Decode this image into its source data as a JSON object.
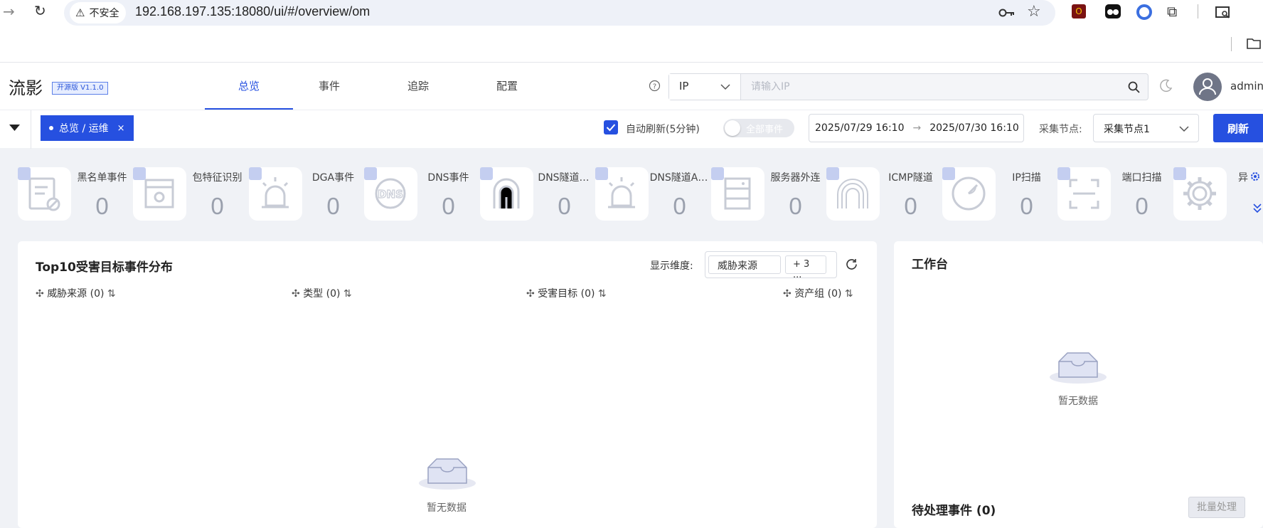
{
  "browser": {
    "security_label": "不安全",
    "url": "192.168.197.135:18080/ui/#/overview/om"
  },
  "app": {
    "logo": "流影",
    "version": "开源版 V1.1.0",
    "nav": [
      "总览",
      "事件",
      "追踪",
      "配置"
    ],
    "active_nav": "总览",
    "search_type": "IP",
    "search_placeholder": "请输入IP",
    "user": "admin"
  },
  "toolbar": {
    "breadcrumb": "总览 / 运维",
    "auto_refresh_label": "自动刷新(5分钟)",
    "auto_refresh_checked": true,
    "all_events_label": "全部事件",
    "date_start": "2025/07/29 16:10",
    "date_arrow": "→",
    "date_end": "2025/07/30 16:10",
    "node_label": "采集节点:",
    "node_value": "采集节点1",
    "refresh_label": "刷新"
  },
  "event_cards": [
    {
      "label": "黑名单事件",
      "count": "0",
      "icon": "blacklist-icon"
    },
    {
      "label": "包特征识别",
      "count": "0",
      "icon": "packet-icon"
    },
    {
      "label": "DGA事件",
      "count": "0",
      "icon": "alarm-icon"
    },
    {
      "label": "DNS事件",
      "count": "0",
      "icon": "dns-icon"
    },
    {
      "label": "DNS隧道…",
      "count": "0",
      "icon": "tunnel-icon"
    },
    {
      "label": "DNS隧道A…",
      "count": "0",
      "icon": "alarm-icon"
    },
    {
      "label": "服务器外连",
      "count": "0",
      "icon": "server-icon"
    },
    {
      "label": "ICMP隧道",
      "count": "0",
      "icon": "tunnel-icon"
    },
    {
      "label": "IP扫描",
      "count": "0",
      "icon": "radar-icon"
    },
    {
      "label": "端口扫描",
      "count": "0",
      "icon": "scan-icon"
    },
    {
      "label": "异",
      "count": "",
      "icon": "gear-icon"
    }
  ],
  "top10": {
    "title": "Top10受害目标事件分布",
    "dimension_label": "显示维度:",
    "dimension_value": "威胁来源",
    "dimension_more": "+ 3 ...",
    "columns": [
      "威胁来源 (0)",
      "类型 (0)",
      "受害目标 (0)",
      "资产组 (0)"
    ],
    "empty_text": "暂无数据"
  },
  "workbench": {
    "title": "工作台",
    "empty_text": "暂无数据",
    "pending_title": "待处理事件 (0)",
    "batch_label": "批量处理"
  }
}
